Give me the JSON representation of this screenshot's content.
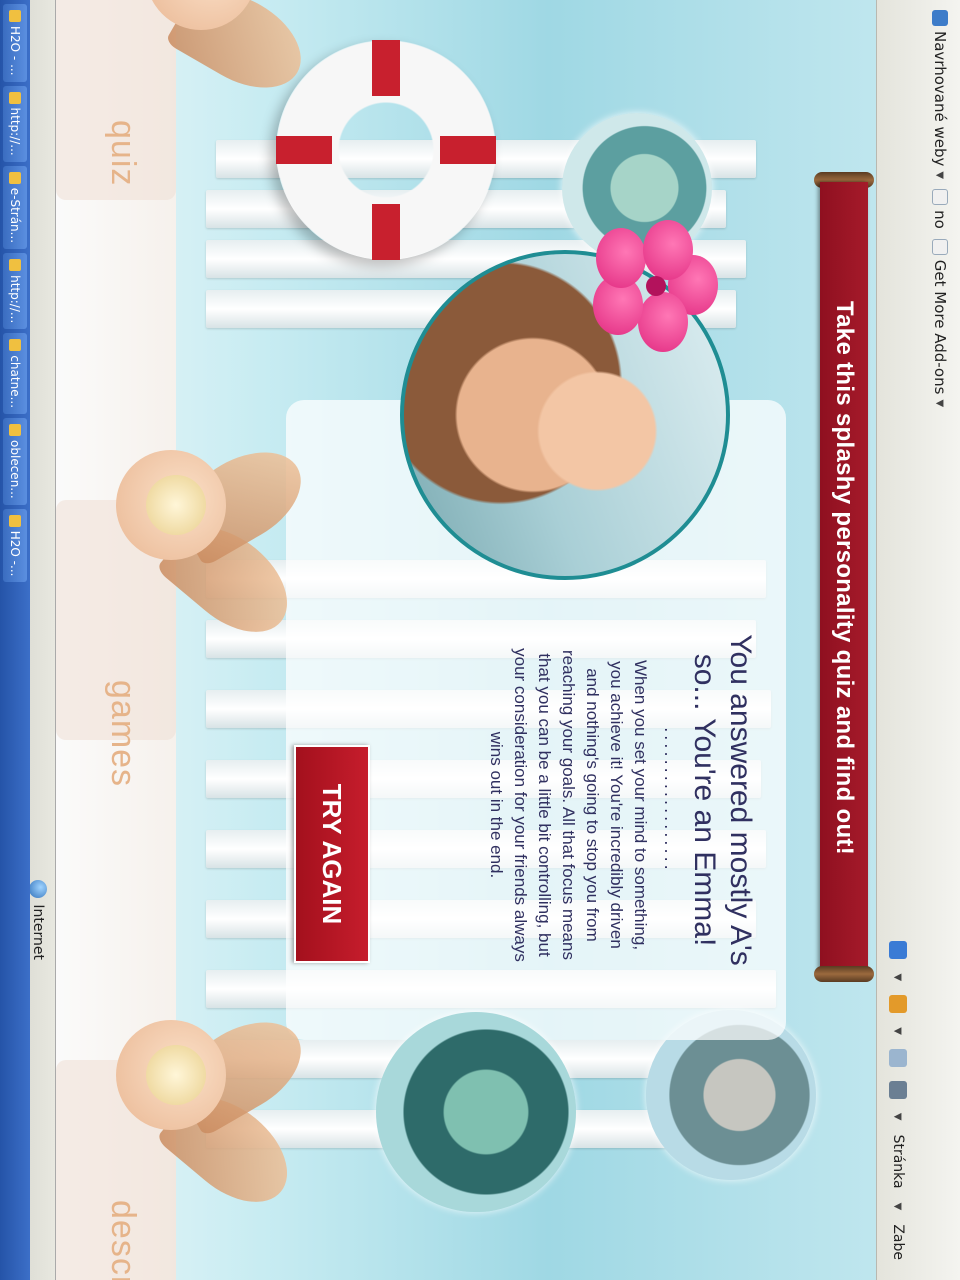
{
  "browser": {
    "bookmarks": [
      {
        "label": "Navrhované weby",
        "icon": "ie-page-icon"
      },
      {
        "label": "no",
        "icon": "ie-page-icon"
      },
      {
        "label": "Get More Add-ons",
        "icon": "ie-page-icon"
      }
    ],
    "commands": {
      "page_label": "Stránka",
      "extra_label": "Zabe"
    }
  },
  "page": {
    "banner": "Take this splashy personality quiz and find out!",
    "result": {
      "heading_line1": "You answered mostly A's",
      "heading_line2": "so... You're an Emma!",
      "dots": "..................",
      "body_line1": "When you set your mind to something,",
      "body_line2": "you achieve it! You're incredibly driven",
      "body_line3": "and nothing's going to stop you from",
      "body_line4": "reaching your goals. All that focus means",
      "body_line5": "that you can be a little bit controlling, but",
      "body_line6": "your consideration for your friends always",
      "body_line7": "wins out in the end."
    },
    "try_again_label": "TRY AGAIN",
    "nav": [
      {
        "label": "quiz"
      },
      {
        "label": "games"
      },
      {
        "label": "descr"
      }
    ]
  },
  "status": {
    "zone_label": "Internet"
  },
  "taskbar": [
    {
      "label": "H2O - ..."
    },
    {
      "label": "http://..."
    },
    {
      "label": "e-Strán..."
    },
    {
      "label": "http://..."
    },
    {
      "label": "chatne..."
    },
    {
      "label": "oblecen..."
    },
    {
      "label": "H2O -..."
    }
  ],
  "colors": {
    "banner": "#a51a2a",
    "text": "#303060",
    "button": "#c61d2c",
    "nav_text": "#e6b48a"
  }
}
